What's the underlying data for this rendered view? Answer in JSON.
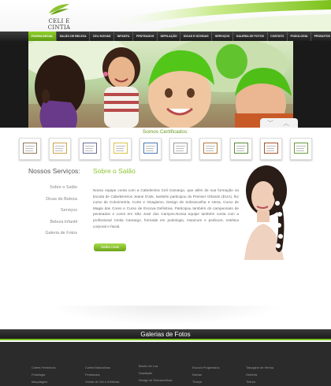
{
  "brand": {
    "logo_text": "CELI E CINTIA"
  },
  "nav": {
    "items": [
      {
        "label": "Página Inicial",
        "active": true
      },
      {
        "label": "Salão de Beleza",
        "active": false
      },
      {
        "label": "Celi Noivas",
        "active": false
      },
      {
        "label": "Infantil",
        "active": false
      },
      {
        "label": "Penteados",
        "active": false
      },
      {
        "label": "Depilação",
        "active": false
      },
      {
        "label": "Dicas e Dúvidas",
        "active": false
      },
      {
        "label": "Serviços",
        "active": false
      },
      {
        "label": "Galeria de Fotos",
        "active": false
      },
      {
        "label": "Contato",
        "active": false
      },
      {
        "label": "Podologia",
        "active": false
      },
      {
        "label": "Produtos",
        "active": false
      }
    ]
  },
  "banner": {
    "prev_glyph": "﹀",
    "next_glyph": "︿"
  },
  "certificates": {
    "title": "Somos Certificados:",
    "items": [
      {
        "name": "certificate-1",
        "color": "#8a7a5a"
      },
      {
        "name": "certificate-2",
        "color": "#c8a64a"
      },
      {
        "name": "certificate-3",
        "color": "#6a6a9a"
      },
      {
        "name": "certificate-4",
        "color": "#d6c24a"
      },
      {
        "name": "certificate-5",
        "color": "#4a7ab0"
      },
      {
        "name": "certificate-6",
        "color": "#9a9a9a"
      },
      {
        "name": "certificate-7",
        "color": "#b07a3a"
      },
      {
        "name": "certificate-8",
        "color": "#5a8a3a"
      },
      {
        "name": "certificate-9",
        "color": "#a0522d"
      },
      {
        "name": "certificate-10",
        "color": "#6a9a3a"
      }
    ]
  },
  "services": {
    "title": "Nossos Serviços:",
    "items": [
      "Sobre o Salão",
      "Dicas de Beleza",
      "Serviços",
      "Beleza Infantil",
      "Galeria de Fotos"
    ]
  },
  "about": {
    "title": "Sobre o Salão",
    "text": "Nosso equipe conta com a Cabelereira Celi Camargo, que além de sua formação na Escola de Cabeleireiros Jeane D'ark, também participou do Premier Orlando (EUA), fez curso de Colorimetria, Corte e Visagismo, Design de Sobrancelha e Hena, Curso de Magia das Cores e Curso de Escova Definitiva. Participou também do campeonato de penteados e cores em São José dos Campos.Nossa equipe também conta com a profissional Cintia Camargo, formada em podologia, manicure e pedicure, estética corporal e facial.",
    "button": "Saiba mais"
  },
  "gallery": {
    "title": "Galerias de Fotos",
    "columns": [
      [
        "Cortes Femininos",
        "Podologia",
        "Maquiagem"
      ],
      [
        "Cortes Masculinos",
        "Penteados",
        "Unhas de Gel e Artificiais"
      ],
      [
        "Banho de Lua",
        "Depilação",
        "Design de Sobrancelhas"
      ],
      [
        "Escova Progressiva",
        "Noivas",
        "Trança"
      ],
      [
        "Tatuagem de Henna",
        "Ombréa",
        "Tintura"
      ]
    ]
  },
  "colors": {
    "accent": "#8cc332",
    "dark": "#1e1e1e"
  }
}
